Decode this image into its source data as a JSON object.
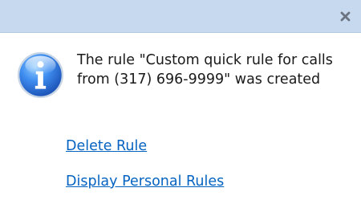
{
  "titlebar": {
    "close_glyph": "x",
    "background_color": "#c7d9ee"
  },
  "notification": {
    "icon": "info-icon",
    "message": "The rule \"Custom quick rule for calls from (317) 696-9999\" was created"
  },
  "actions": {
    "delete_rule": "Delete Rule",
    "display_personal_rules": "Display Personal Rules"
  },
  "colors": {
    "link": "#0563c1",
    "icon_blue": "#2f6fd6"
  }
}
